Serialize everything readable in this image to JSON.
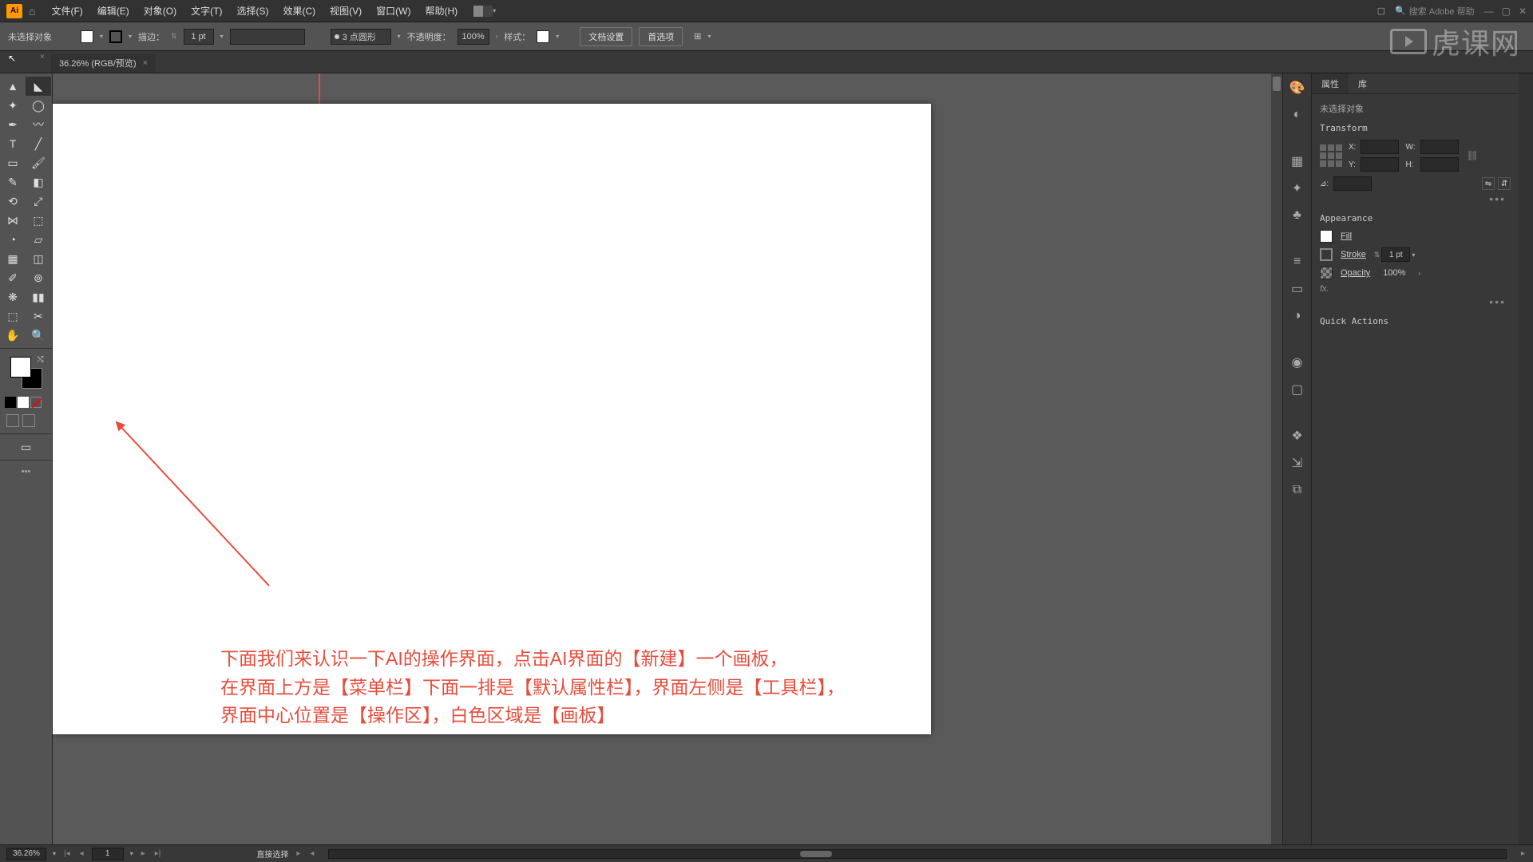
{
  "titlebar": {
    "logo": "Ai",
    "menus": [
      "文件(F)",
      "编辑(E)",
      "对象(O)",
      "文字(T)",
      "选择(S)",
      "效果(C)",
      "视图(V)",
      "窗口(W)",
      "帮助(H)"
    ],
    "search_placeholder": "搜索 Adobe 帮助"
  },
  "controlbar": {
    "no_selection": "未选择对象",
    "stroke_label": "描边：",
    "stroke_value": "1 pt",
    "profile_label": "3 点圆形",
    "opacity_label": "不透明度：",
    "opacity_value": "100%",
    "style_label": "样式：",
    "doc_setup": "文档设置",
    "prefs": "首选项"
  },
  "tab": {
    "title": "36.26% (RGB/预览)"
  },
  "canvas": {
    "annotation_line1": "下面我们来认识一下AI的操作界面，点击AI界面的【新建】一个画板，",
    "annotation_line2": "在界面上方是【菜单栏】下面一排是【默认属性栏】，界面左侧是【工具栏】，",
    "annotation_line3": "界面中心位置是【操作区】，白色区域是【画板】"
  },
  "properties": {
    "tab_props": "属性",
    "tab_lib": "库",
    "no_selection": "未选择对象",
    "transform": "Transform",
    "x_label": "X:",
    "y_label": "Y:",
    "w_label": "W:",
    "h_label": "H:",
    "angle_label": "⊿:",
    "appearance": "Appearance",
    "fill": "Fill",
    "stroke": "Stroke",
    "stroke_value": "1 pt",
    "opacity": "Opacity",
    "opacity_value": "100%",
    "fx": "fx.",
    "quick_actions": "Quick Actions"
  },
  "statusbar": {
    "zoom": "36.26%",
    "artboard": "1",
    "tool_hint": "直接选择"
  },
  "watermark": "虎课网"
}
